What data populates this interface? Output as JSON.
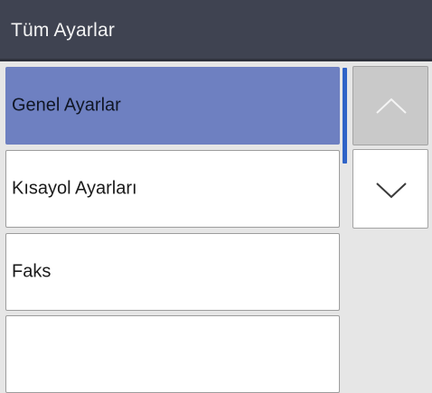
{
  "header": {
    "title": "Tüm Ayarlar"
  },
  "menu": {
    "items": [
      {
        "label": "Genel Ayarlar",
        "selected": true
      },
      {
        "label": "Kısayol Ayarları",
        "selected": false
      },
      {
        "label": "Faks",
        "selected": false
      },
      {
        "label": "",
        "selected": false
      }
    ]
  },
  "scroll": {
    "up_icon": "chevron-up-icon",
    "down_icon": "chevron-down-icon",
    "up_enabled": false,
    "down_enabled": true
  },
  "colors": {
    "header_bg": "#3f4351",
    "selected_item": "#6e80c1",
    "scroll_indicator": "#2f63c7",
    "disabled_button": "#c9c9c9"
  }
}
